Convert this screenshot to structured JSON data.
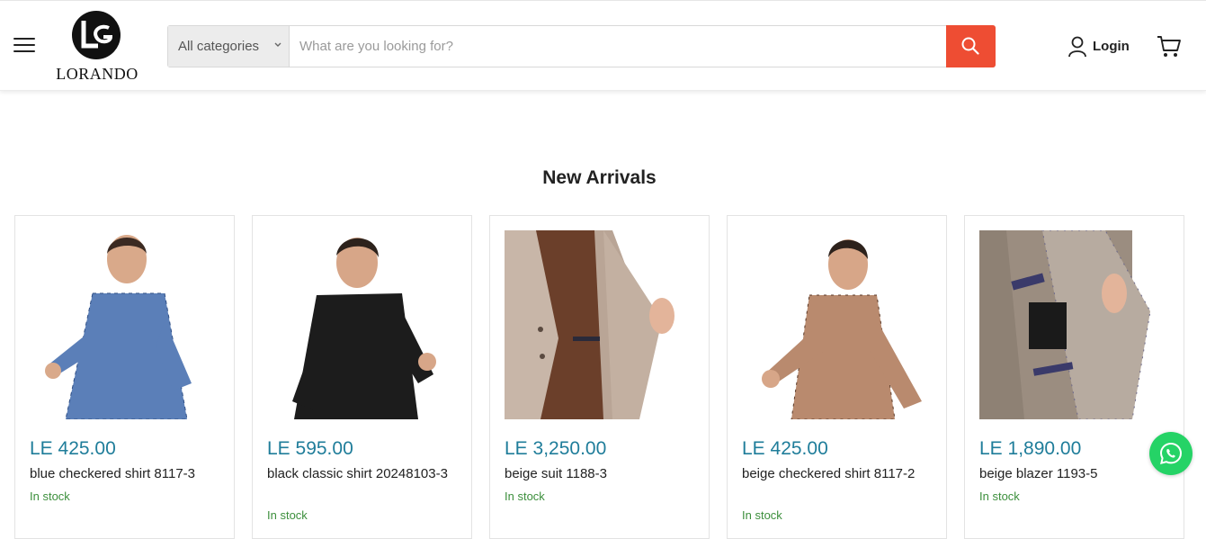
{
  "header": {
    "logo_text": "LORANDO",
    "category_select": "All categories",
    "search_placeholder": "What are you looking for?",
    "login_label": "Login"
  },
  "section": {
    "title": "New Arrivals"
  },
  "products": [
    {
      "price": "LE 425.00",
      "title": "blue checkered shirt 8117-3",
      "stock": "In stock",
      "image": "man-in-blue-checkered-shirt"
    },
    {
      "price": "LE 595.00",
      "title": "black classic shirt 20248103-3",
      "stock": "In stock",
      "image": "man-in-black-shirt"
    },
    {
      "price": "LE 3,250.00",
      "title": "beige suit 1188-3",
      "stock": "In stock",
      "image": "beige-suit-jacket-lining"
    },
    {
      "price": "LE 425.00",
      "title": "beige checkered shirt 8117-2",
      "stock": "In stock",
      "image": "man-in-beige-checkered-shirt"
    },
    {
      "price": "LE 1,890.00",
      "title": "beige blazer 1193-5",
      "stock": "In stock",
      "image": "beige-blazer-lining-with-label"
    }
  ],
  "colors": {
    "accent": "#ee4d33",
    "price": "#1f7d9a",
    "stock": "#3c8f3c",
    "whatsapp": "#25d366"
  }
}
